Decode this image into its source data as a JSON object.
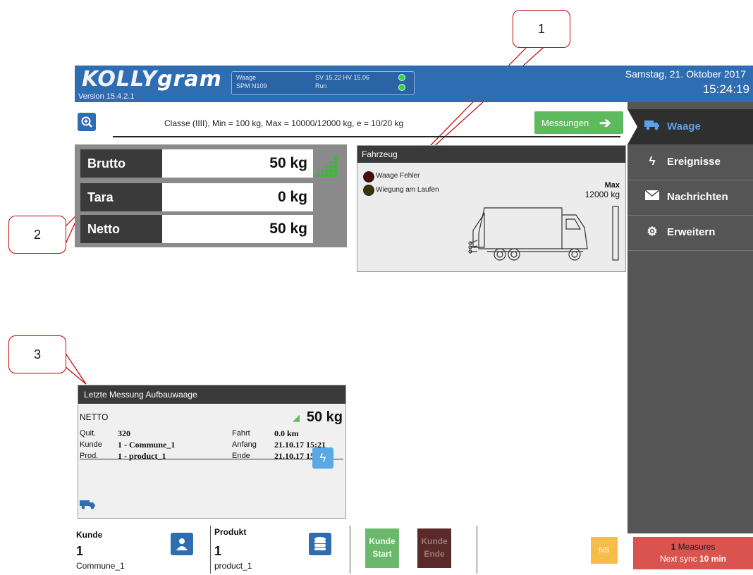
{
  "header": {
    "logo_main": "KOLLY",
    "logo_suffix": "gram",
    "version": "Version 15.4.2.1",
    "status": {
      "l1": "Waage",
      "l2": "SPM N109",
      "l3": "SV 15.22  HV  15.06",
      "l4": "Run"
    },
    "date": "Samstag, 21. Oktober 2017",
    "time": "15:24:19"
  },
  "info_bar": {
    "class_text": "Classe (IIII), Min = 100 kg, Max = 10000/12000 kg, e = 10/20 kg",
    "messungen": "Messungen"
  },
  "weights": {
    "brutto_label": "Brutto",
    "brutto_value": "50 kg",
    "tara_label": "Tara",
    "tara_value": "0 kg",
    "netto_label": "Netto",
    "netto_value": "50 kg"
  },
  "vehicle": {
    "title": "Fahrzeug",
    "led1": "Waage Fehler",
    "led2": "Wiegung am Laufen",
    "max_label": "Max",
    "max_value": "12000 kg"
  },
  "sidebar": {
    "items": [
      {
        "label": "Waage",
        "icon": "truck-icon"
      },
      {
        "label": "Ereignisse",
        "icon": "flash-icon"
      },
      {
        "label": "Nachrichten",
        "icon": "envelope-icon"
      },
      {
        "label": "Erweitern",
        "icon": "gears-icon"
      }
    ]
  },
  "last": {
    "title": "Letzte Messung Aufbauwaage",
    "netto_label": "NETTO",
    "netto_value": "50 kg",
    "quit_label": "Quit.",
    "quit_value": "320",
    "kunde_label": "Kunde",
    "kunde_value": "1 - Commune_1",
    "prod_label": "Prod.",
    "prod_value": "1 - product_1",
    "fahrt_label": "Fahrt",
    "fahrt_value": "0.0 km",
    "anfang_label": "Anfang",
    "anfang_value": "21.10.17 15:21",
    "ende_label": "Ende",
    "ende_value": "21.10.17 15:24"
  },
  "bottom": {
    "kunde_label": "Kunde",
    "kunde_num": "1",
    "kunde_name": "Commune_1",
    "produkt_label": "Produkt",
    "produkt_num": "1",
    "produkt_name": "product_1",
    "kunde_start_1": "Kunde",
    "kunde_start_2": "Start",
    "kunde_ende_1": "Kunde",
    "kunde_ende_2": "Ende",
    "ns": "NS"
  },
  "sync": {
    "count": "1",
    "measures": "Measures",
    "next_prefix": "Next sync",
    "next_value": "10 min"
  },
  "callouts": {
    "c1": "1",
    "c2": "2",
    "c3": "3"
  },
  "colors": {
    "header_blue": "#2f6db3",
    "sidebar": "#555555",
    "green": "#5dba5f",
    "sync_red": "#d9534f"
  }
}
